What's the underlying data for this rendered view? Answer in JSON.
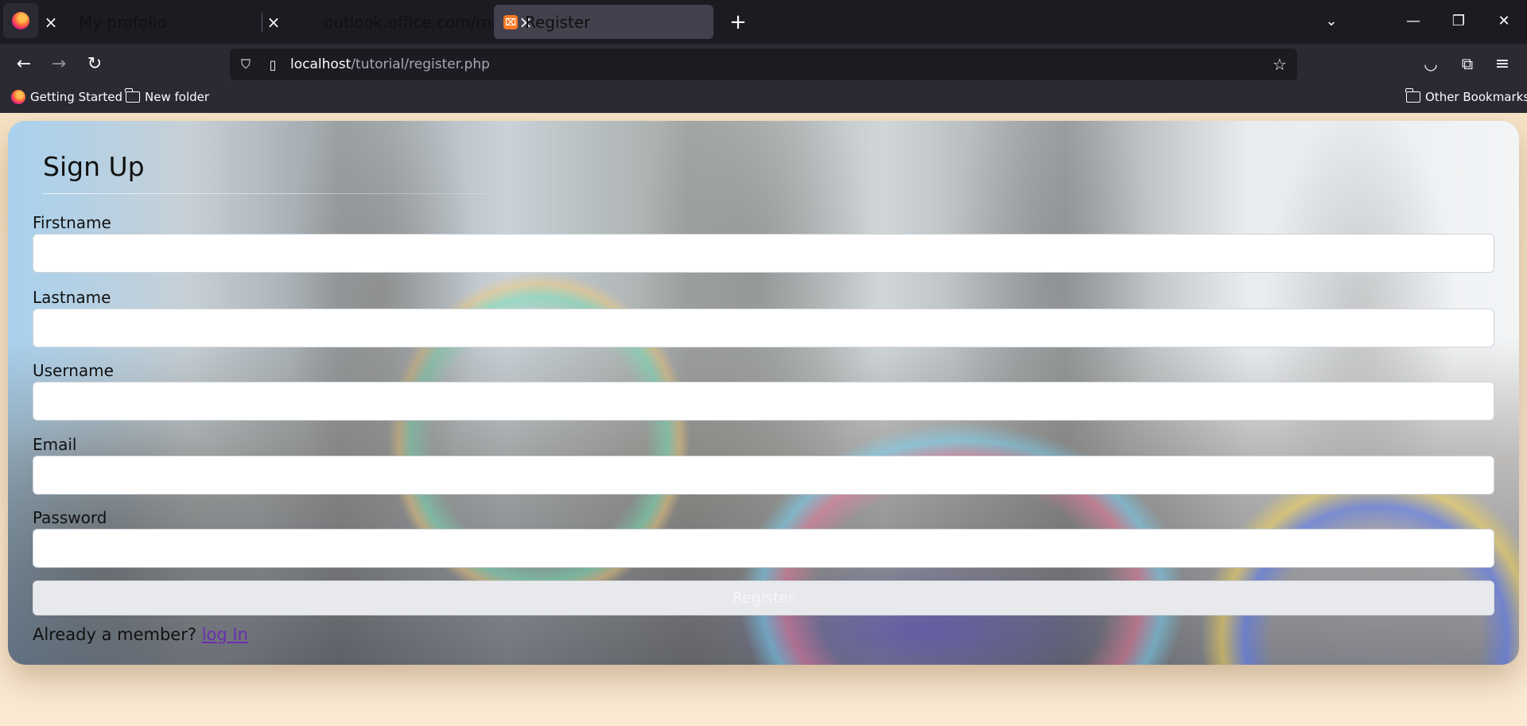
{
  "browser": {
    "tabs": [
      {
        "title": "My profolio",
        "active": false
      },
      {
        "title": "outlook.office.com/mail/oauthRedirect",
        "active": false
      },
      {
        "title": "Register",
        "active": true,
        "favicon_text": "⌧"
      }
    ],
    "url_host": "localhost",
    "url_path": "/tutorial/register.php",
    "bookmarks": [
      {
        "label": "Getting Started",
        "icon": "firefox-icon"
      },
      {
        "label": "New folder",
        "icon": "folder-icon"
      }
    ],
    "other_bookmarks": "Other Bookmarks",
    "icons": {
      "back": "←",
      "forward": "→",
      "reload": "↻",
      "new_tab": "+",
      "list_tabs": "⌄",
      "minimize": "—",
      "restore": "❐",
      "close": "✕",
      "star": "☆",
      "tab_close": "×",
      "shield": "⛉",
      "page": "▯",
      "pocket": "◡",
      "extensions": "⧉",
      "menu": "≡"
    },
    "accent": "#fb7a24"
  },
  "form": {
    "title": "Sign Up",
    "fields": [
      {
        "label": "Firstname",
        "value": ""
      },
      {
        "label": "Lastname",
        "value": ""
      },
      {
        "label": "Username",
        "value": ""
      },
      {
        "label": "Email",
        "value": ""
      },
      {
        "label": "Password",
        "value": ""
      }
    ],
    "submit_label": "Register",
    "member_prompt": "Already a member?",
    "login_link": "log In",
    "link_color": "#6a2fb0"
  }
}
